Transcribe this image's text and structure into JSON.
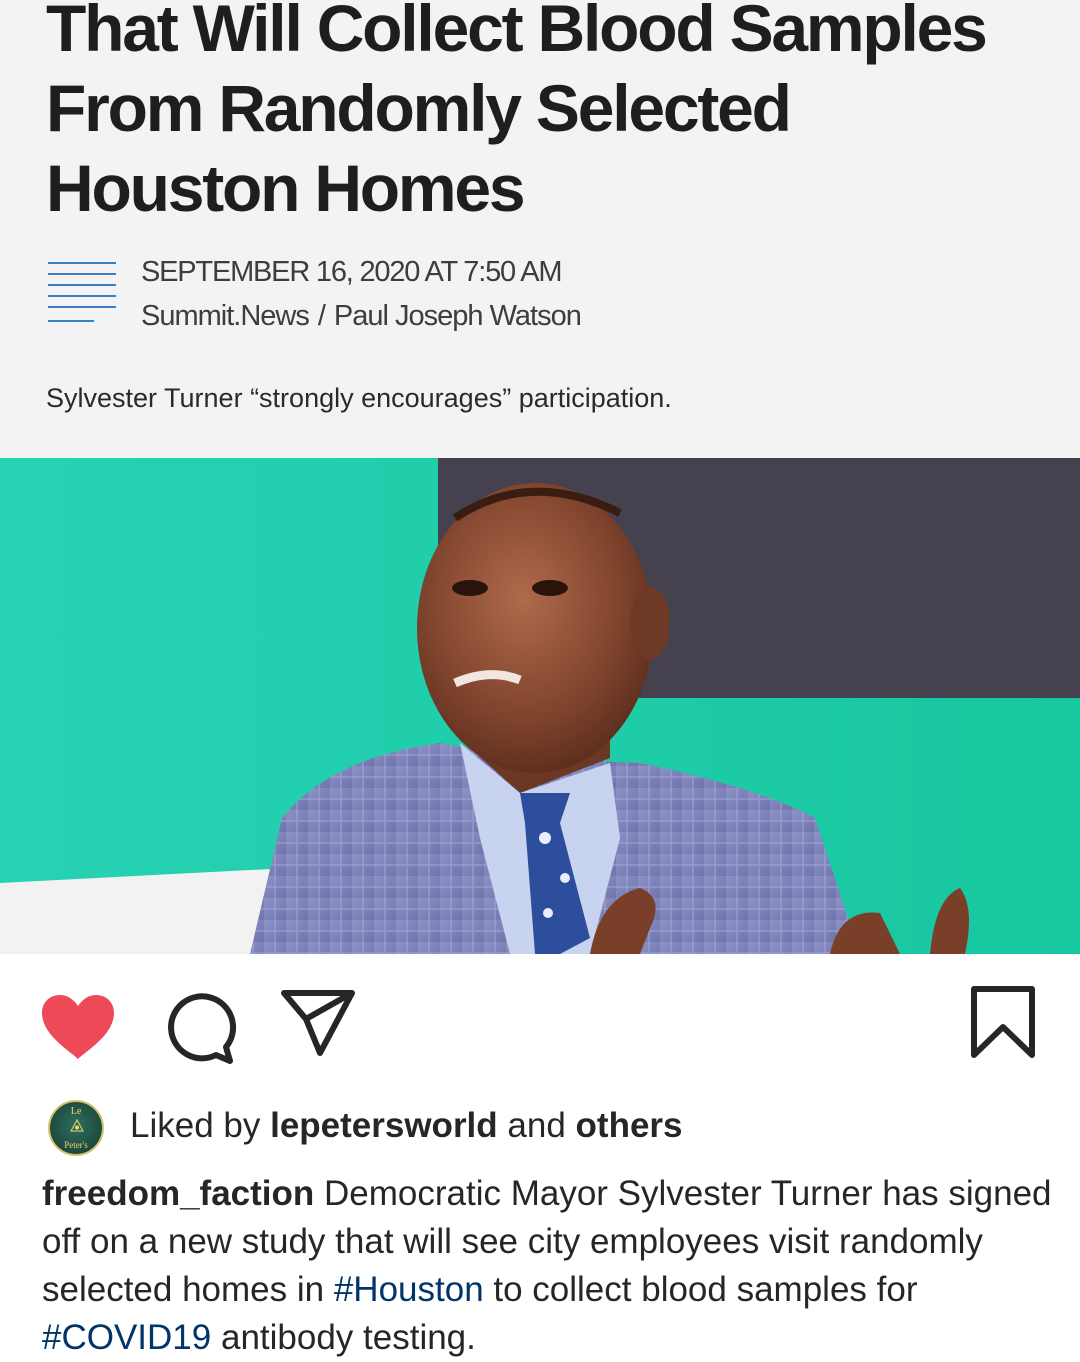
{
  "article": {
    "headline_lines": [
      "That Will Collect Blood Samples",
      "From Randomly Selected",
      "Houston Homes"
    ],
    "date": "SEPTEMBER 16, 2020 AT 7:50 AM",
    "source": "Summit.News",
    "separator": "/",
    "author": "Paul Joseph Watson",
    "subtitle": "Sylvester Turner “strongly encourages” participation.",
    "menu_icon": "lines-icon",
    "accent_color": "#3a7fc4"
  },
  "post": {
    "icons": {
      "like": "heart-icon",
      "comment": "comment-icon",
      "share": "paper-plane-icon",
      "save": "bookmark-icon"
    },
    "like_color": "#ed4956",
    "avatar": {
      "top_text": "Le",
      "bottom_text": "Peter's"
    },
    "liked_prefix": "Liked by ",
    "liked_user": "lepetersworld",
    "liked_mid": " and ",
    "liked_others": "others",
    "caption": {
      "username": "freedom_faction",
      "text1": " Democratic Mayor Sylvester Turner has signed off on a new study that will see city employees visit randomly selected homes in ",
      "tag1": "#Houston",
      "text2": " to collect blood samples for ",
      "tag2": "#COVID19",
      "text3": " antibody testing."
    },
    "hashtag_color": "#003569"
  }
}
